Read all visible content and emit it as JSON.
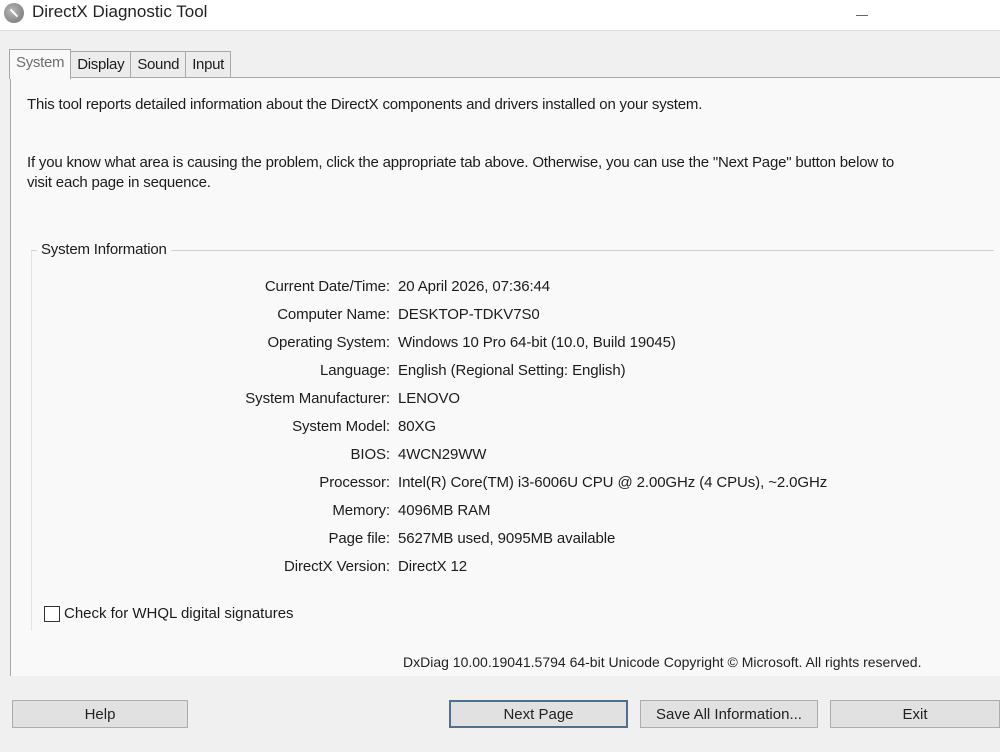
{
  "window": {
    "title": "DirectX Diagnostic Tool"
  },
  "tabs": [
    {
      "label": "System",
      "active": true
    },
    {
      "label": "Display",
      "active": false
    },
    {
      "label": "Sound",
      "active": false
    },
    {
      "label": "Input",
      "active": false
    }
  ],
  "intro": {
    "line1": "This tool reports detailed information about the DirectX components and drivers installed on your system.",
    "line2": "If you know what area is causing the problem, click the appropriate tab above.  Otherwise, you can use the \"Next Page\" button below to\nvisit each page in sequence."
  },
  "system_info": {
    "group_title": "System Information",
    "rows": [
      {
        "label": "Current Date/Time:",
        "value": "20 April 2026, 07:36:44"
      },
      {
        "label": "Computer Name:",
        "value": "DESKTOP-TDKV7S0"
      },
      {
        "label": "Operating System:",
        "value": "Windows 10 Pro 64-bit (10.0, Build 19045)"
      },
      {
        "label": "Language:",
        "value": "English (Regional Setting: English)"
      },
      {
        "label": "System Manufacturer:",
        "value": "LENOVO"
      },
      {
        "label": "System Model:",
        "value": "80XG"
      },
      {
        "label": "BIOS:",
        "value": "4WCN29WW"
      },
      {
        "label": "Processor:",
        "value": "Intel(R) Core(TM) i3-6006U CPU @ 2.00GHz (4 CPUs), ~2.0GHz"
      },
      {
        "label": "Memory:",
        "value": "4096MB RAM"
      },
      {
        "label": "Page file:",
        "value": "5627MB used, 9095MB available"
      },
      {
        "label": "DirectX Version:",
        "value": "DirectX 12"
      }
    ]
  },
  "whql": {
    "label": "Check for WHQL digital signatures",
    "checked": false
  },
  "footer": {
    "copyright": "DxDiag 10.00.19041.5794 64-bit Unicode  Copyright © Microsoft. All rights reserved."
  },
  "buttons": {
    "help": "Help",
    "next_page": "Next Page",
    "save_all": "Save All Information...",
    "exit": "Exit"
  }
}
